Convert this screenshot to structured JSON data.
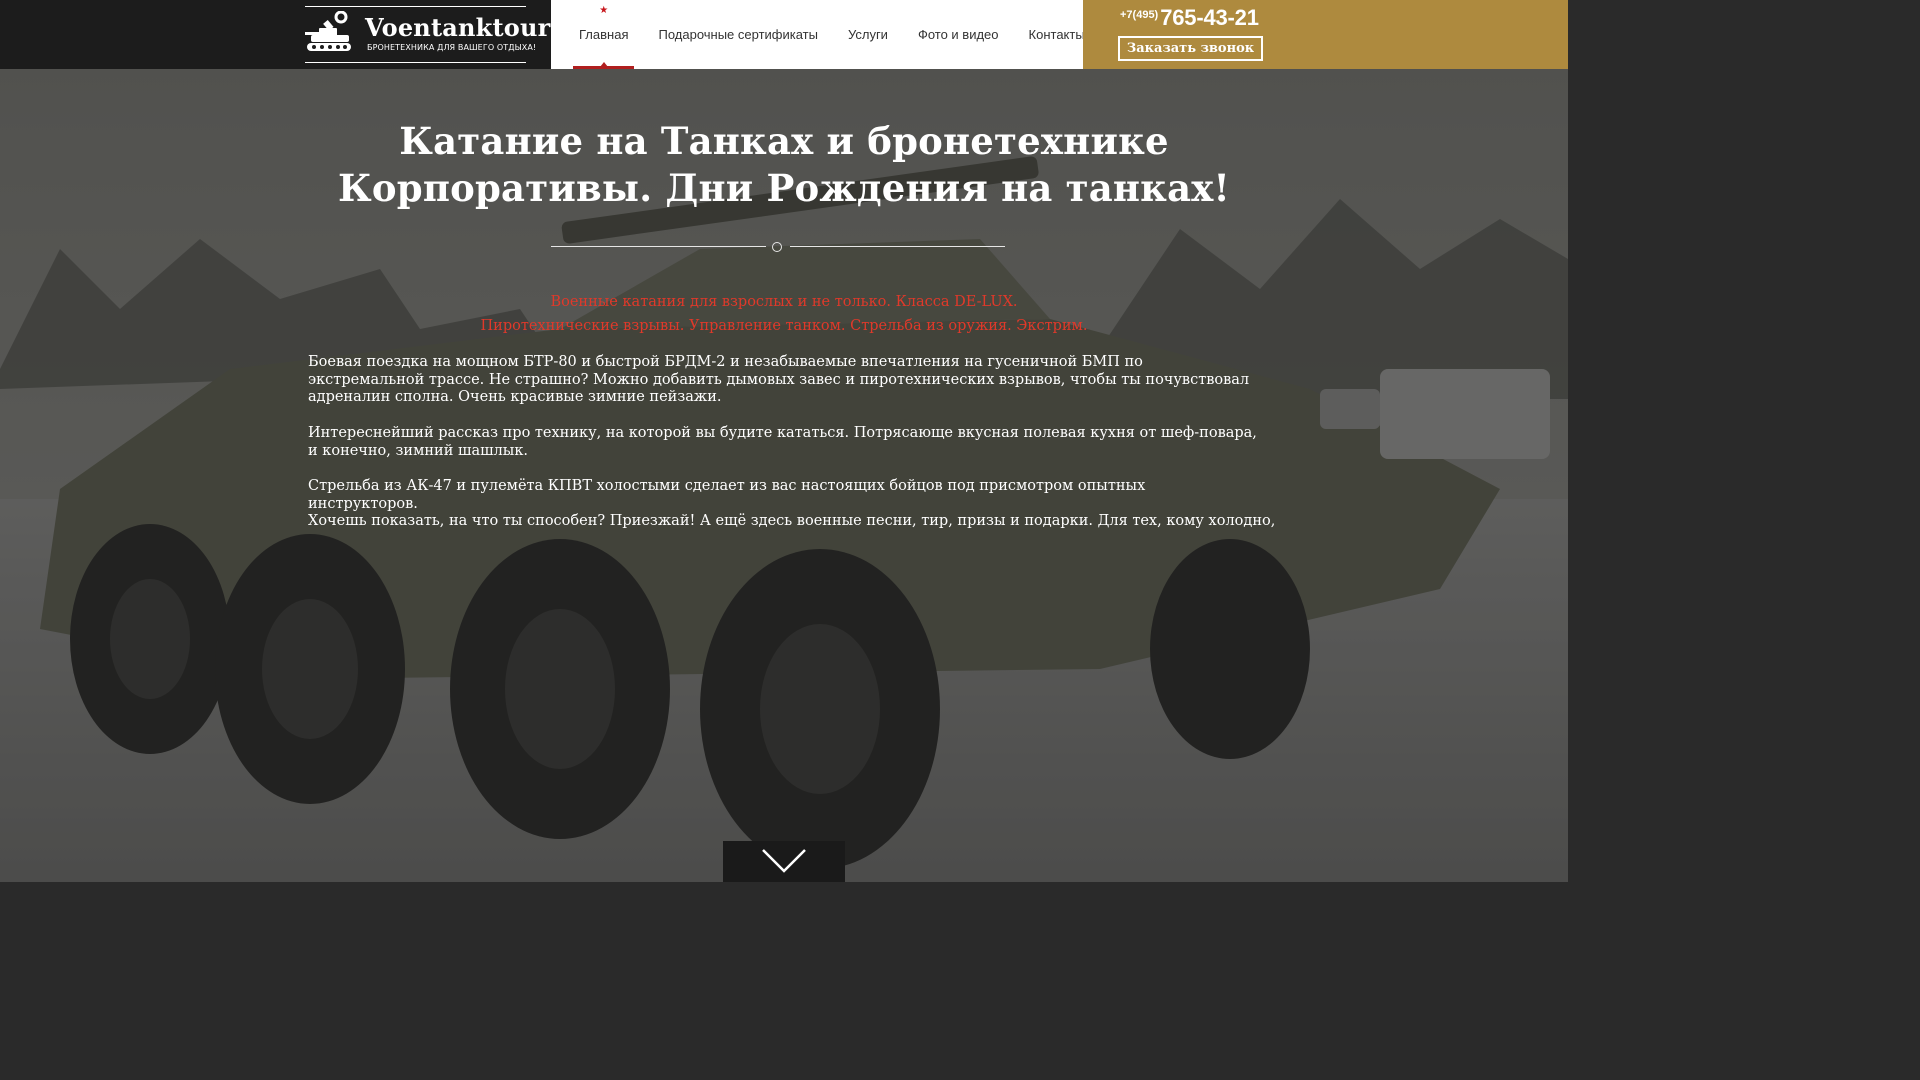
{
  "header": {
    "logo": {
      "title": "Voentanktour",
      "subtitle": "БРОНЕТЕХНИКА ДЛЯ ВАШЕГО ОТДЫХА!",
      "icon": "tank-icon"
    },
    "nav": {
      "items": [
        {
          "label": "Главная",
          "active": true
        },
        {
          "label": "Подарочные сертификаты",
          "active": false
        },
        {
          "label": "Услуги",
          "active": false
        },
        {
          "label": "Фото и видео",
          "active": false
        },
        {
          "label": "Контакты",
          "active": false
        }
      ]
    },
    "phone": {
      "prefix": "+7(495)",
      "number": "765-43-21"
    },
    "callback_label": "Заказать звонок"
  },
  "hero": {
    "title_line1": "Катание на Танках и бронетехнике",
    "title_line2": "Корпоративы. Дни Рождения на танках!",
    "tagline_line1": "Военные катания для взрослых и не только. Класса DE-LUX.",
    "tagline_line2": "Пиротехнические взрывы. Управление танком. Стрельба из оружия. Экстрим.",
    "paragraphs": [
      "Боевая поездка на мощном БТР-80 и быстрой БРДМ-2 и незабываемые впечатления на гусеничной БМП по экстремальной трассе. Не страшно? Можно добавить дымовых завес и пиротехнических взрывов, чтобы ты почувствовал адреналин сполна. Очень красивые зимние пейзажи.",
      "Интереснейший рассказ про технику, на которой вы будите кататься. Потрясающе вкусная полевая кухня от шеф-повара, и конечно, зимний шашлык.",
      "Стрельба из АК-47 и пулемёта КПВТ холостыми сделает из вас настоящих бойцов под присмотром опытных инструкторов.",
      "Хочешь показать, на что ты способен? Приезжай! А ещё здесь военные песни, тир, призы и подарки. Для тех, кому холодно,"
    ],
    "scroll_icon": "chevron-down-icon"
  },
  "colors": {
    "accent_gold": "#ae8a3e",
    "header_dark": "#1c1c1c",
    "tagline_red": "#e0392a",
    "active_red": "#b01f1f"
  }
}
